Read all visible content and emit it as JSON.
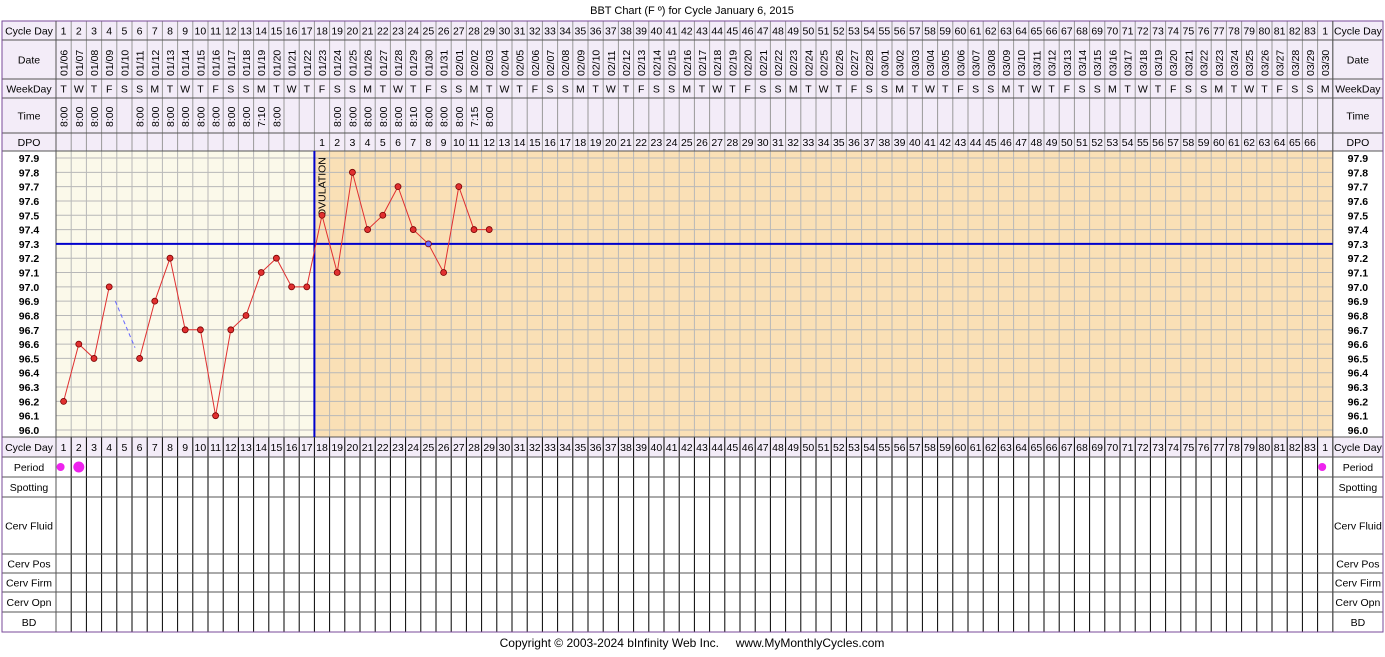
{
  "chart_data": {
    "type": "line",
    "title": "BBT Chart (F º) for Cycle January 6, 2015",
    "row_labels": {
      "cycle_day": "Cycle Day",
      "date": "Date",
      "weekday": "WeekDay",
      "time": "Time",
      "dpo": "DPO",
      "period": "Period",
      "spotting": "Spotting",
      "cerv_fluid": "Cerv Fluid",
      "cerv_pos": "Cerv Pos",
      "cerv_firm": "Cerv Firm",
      "cerv_opn": "Cerv Opn",
      "bd": "BD"
    },
    "cycle_days": [
      1,
      2,
      3,
      4,
      5,
      6,
      7,
      8,
      9,
      10,
      11,
      12,
      13,
      14,
      15,
      16,
      17,
      18,
      19,
      20,
      21,
      22,
      23,
      24,
      25,
      26,
      27,
      28,
      29,
      30,
      31,
      32,
      33,
      34,
      35,
      36,
      37,
      38,
      39,
      40,
      41,
      42,
      43,
      44,
      45,
      46,
      47,
      48,
      49,
      50,
      51,
      52,
      53,
      54,
      55,
      56,
      57,
      58,
      59,
      60,
      61,
      62,
      63,
      64,
      65,
      66,
      67,
      68,
      69,
      70,
      71,
      72,
      73,
      74,
      75,
      76,
      77,
      78,
      79,
      80,
      81,
      82,
      83,
      1
    ],
    "dates": [
      "01/06",
      "01/07",
      "01/08",
      "01/09",
      "01/10",
      "01/11",
      "01/12",
      "01/13",
      "01/14",
      "01/15",
      "01/16",
      "01/17",
      "01/18",
      "01/19",
      "01/20",
      "01/21",
      "01/22",
      "01/23",
      "01/24",
      "01/25",
      "01/26",
      "01/27",
      "01/28",
      "01/29",
      "01/30",
      "01/31",
      "02/01",
      "02/02",
      "02/03",
      "02/04",
      "02/05",
      "02/06",
      "02/07",
      "02/08",
      "02/09",
      "02/10",
      "02/11",
      "02/12",
      "02/13",
      "02/14",
      "02/15",
      "02/16",
      "02/17",
      "02/18",
      "02/19",
      "02/20",
      "02/21",
      "02/22",
      "02/23",
      "02/24",
      "02/25",
      "02/26",
      "02/27",
      "02/28",
      "03/01",
      "03/02",
      "03/03",
      "03/04",
      "03/05",
      "03/06",
      "03/07",
      "03/08",
      "03/09",
      "03/10",
      "03/11",
      "03/12",
      "03/13",
      "03/14",
      "03/15",
      "03/16",
      "03/17",
      "03/18",
      "03/19",
      "03/20",
      "03/21",
      "03/22",
      "03/23",
      "03/24",
      "03/25",
      "03/26",
      "03/27",
      "03/28",
      "03/29",
      "03/30"
    ],
    "weekdays": [
      "T",
      "W",
      "T",
      "F",
      "S",
      "S",
      "M",
      "T",
      "W",
      "T",
      "F",
      "S",
      "S",
      "M",
      "T",
      "W",
      "T",
      "F",
      "S",
      "S",
      "M",
      "T",
      "W",
      "T",
      "F",
      "S",
      "S",
      "M",
      "T",
      "W",
      "T",
      "F",
      "S",
      "S",
      "M",
      "T",
      "W",
      "T",
      "F",
      "S",
      "S",
      "M",
      "T",
      "W",
      "T",
      "F",
      "S",
      "S",
      "M",
      "T",
      "W",
      "T",
      "F",
      "S",
      "S",
      "M",
      "T",
      "W",
      "T",
      "F",
      "S",
      "S",
      "M",
      "T",
      "W",
      "T",
      "F",
      "S",
      "S",
      "M",
      "T",
      "W",
      "T",
      "F",
      "S",
      "S",
      "M",
      "T",
      "W",
      "T",
      "F",
      "S",
      "S",
      "M"
    ],
    "times": [
      "8:00",
      "8:00",
      "8:00",
      "8:00",
      "",
      "8:00",
      "8:00",
      "8:00",
      "8:00",
      "8:00",
      "8:00",
      "8:00",
      "8:00",
      "7:10",
      "8:00",
      "",
      "",
      "",
      "8:00",
      "8:00",
      "8:00",
      "8:00",
      "8:00",
      "8:10",
      "8:00",
      "8:00",
      "8:00",
      "7:15",
      "8:00"
    ],
    "dpo": [
      "",
      "",
      "",
      "",
      "",
      "",
      "",
      "",
      "",
      "",
      "",
      "",
      "",
      "",
      "",
      "",
      "",
      "1",
      "2",
      "3",
      "4",
      "5",
      "6",
      "7",
      "8",
      "9",
      "10",
      "11",
      "12",
      "13",
      "14",
      "15",
      "16",
      "17",
      "18",
      "19",
      "20",
      "21",
      "22",
      "23",
      "24",
      "25",
      "26",
      "27",
      "28",
      "29",
      "30",
      "31",
      "32",
      "33",
      "34",
      "35",
      "36",
      "37",
      "38",
      "39",
      "40",
      "41",
      "42",
      "43",
      "44",
      "45",
      "46",
      "47",
      "48",
      "49",
      "50",
      "51",
      "52",
      "53",
      "54",
      "55",
      "56",
      "57",
      "58",
      "59",
      "60",
      "61",
      "62",
      "63",
      "64",
      "65",
      "66",
      ""
    ],
    "temperatures": [
      96.2,
      96.6,
      96.5,
      97.0,
      null,
      96.5,
      96.9,
      97.2,
      96.7,
      96.7,
      96.1,
      96.7,
      96.8,
      97.1,
      97.2,
      97.0,
      97.0,
      97.5,
      97.1,
      97.8,
      97.4,
      97.5,
      97.7,
      97.4,
      97.3,
      97.1,
      97.7,
      97.4,
      97.4
    ],
    "discarded_days": [
      25
    ],
    "dashed_gap": [
      4,
      6
    ],
    "ylim": [
      96.0,
      97.9
    ],
    "y_ticks": [
      "97.9",
      "97.8",
      "97.7",
      "97.6",
      "97.5",
      "97.4",
      "97.3",
      "97.2",
      "97.1",
      "97.0",
      "96.9",
      "96.8",
      "96.7",
      "96.6",
      "96.5",
      "96.4",
      "96.3",
      "96.2",
      "96.1",
      "96.0"
    ],
    "coverline": 97.3,
    "ovulation_day": 17,
    "ovulation_label": "OVULATION",
    "period_days": [
      {
        "index": 1,
        "size": "small"
      },
      {
        "index": 2,
        "size": "large"
      },
      {
        "index": 84,
        "size": "small"
      }
    ],
    "colors": {
      "line": "#e03030",
      "coverline": "#0000cc",
      "ovulation": "#0000cc",
      "dot": "#e03030",
      "discarded_dot": "#6666ff",
      "period": "#ee22ee",
      "bg_follicular": "#fbf9ea",
      "bg_luteal": "#fae0b6",
      "header_bg": "#f3ecf8",
      "grid": "#b8b8b8",
      "border": "#7a4a9a"
    }
  },
  "footer": {
    "text": "Copyright © 2003-2024 bInfinity Web Inc.     www.MyMonthlyCycles.com"
  }
}
